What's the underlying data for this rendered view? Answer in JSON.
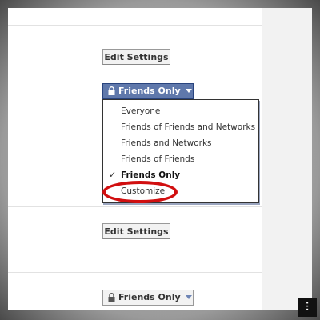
{
  "settings": {
    "edit_settings_1": "Edit Settings",
    "privacy_active_label": "Friends Only",
    "edit_settings_2": "Edit Settings",
    "privacy_bottom_label": "Friends Only"
  },
  "dropdown": {
    "items": [
      {
        "label": "Everyone",
        "selected": false
      },
      {
        "label": "Friends of Friends and Networks",
        "selected": false
      },
      {
        "label": "Friends and Networks",
        "selected": false
      },
      {
        "label": "Friends of Friends",
        "selected": false
      },
      {
        "label": "Friends Only",
        "selected": true
      },
      {
        "label": "Customize",
        "selected": false
      }
    ],
    "check_glyph": "✓"
  },
  "annotation": {
    "highlight_color": "#d10f10",
    "highlighted_item": "Customize"
  },
  "colors": {
    "accent": "#5f78ab",
    "button_bg": "#f2f2f2"
  },
  "badge": "⫶"
}
